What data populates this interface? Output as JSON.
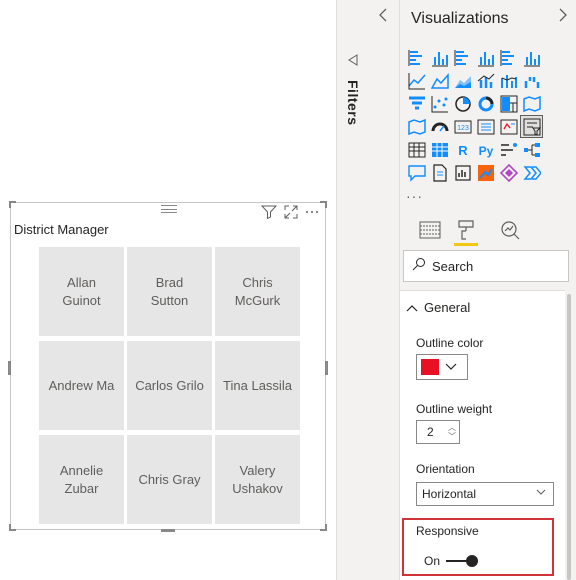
{
  "canvas": {
    "slicer": {
      "title": "District Manager",
      "tiles": [
        "Allan\nGuinot",
        "Brad\nSutton",
        "Chris\nMcGurk",
        "Andrew Ma",
        "Carlos Grilo",
        "Tina Lassila",
        "Annelie\nZubar",
        "Chris Gray",
        "Valery\nUshakov"
      ],
      "header_icons": [
        "filter-icon",
        "focus-mode-icon",
        "more-options-icon"
      ]
    }
  },
  "filters_pane": {
    "label": "Filters"
  },
  "visualizations_pane": {
    "title": "Visualizations",
    "more": "···",
    "icons": [
      "stacked-bar-chart",
      "stacked-column-chart",
      "clustered-bar-chart",
      "clustered-column-chart",
      "100-percent-bar-chart",
      "100-percent-column-chart",
      "line-chart",
      "area-chart",
      "stacked-area-chart",
      "line-and-column-chart",
      "ribbon-chart",
      "waterfall-chart",
      "funnel-chart",
      "scatter-chart",
      "pie-chart",
      "donut-chart",
      "treemap",
      "map",
      "filled-map",
      "gauge",
      "card",
      "multi-row-card",
      "kpi",
      "slicer",
      "table",
      "matrix",
      "r-visual",
      "python-visual",
      "key-influencers",
      "decomposition-tree",
      "qa-visual",
      "paginated-report",
      "smart-narrative",
      "arcgis-map",
      "power-apps",
      "power-automate"
    ],
    "selected_icon": "slicer",
    "tabs": [
      "fields-tab",
      "format-tab",
      "analytics-tab"
    ],
    "active_tab": "format-tab",
    "search": {
      "placeholder": "Search"
    },
    "format": {
      "section": "General",
      "outline_color_label": "Outline color",
      "outline_color_value": "#e81123",
      "outline_weight_label": "Outline weight",
      "outline_weight_value": "2",
      "orientation_label": "Orientation",
      "orientation_value": "Horizontal",
      "responsive_label": "Responsive",
      "responsive_state": "On"
    }
  },
  "colors": {
    "accent": "#f2c811",
    "highlight": "#d13438",
    "icon_blue": "#118dff",
    "tile": "#e6e6e6"
  }
}
